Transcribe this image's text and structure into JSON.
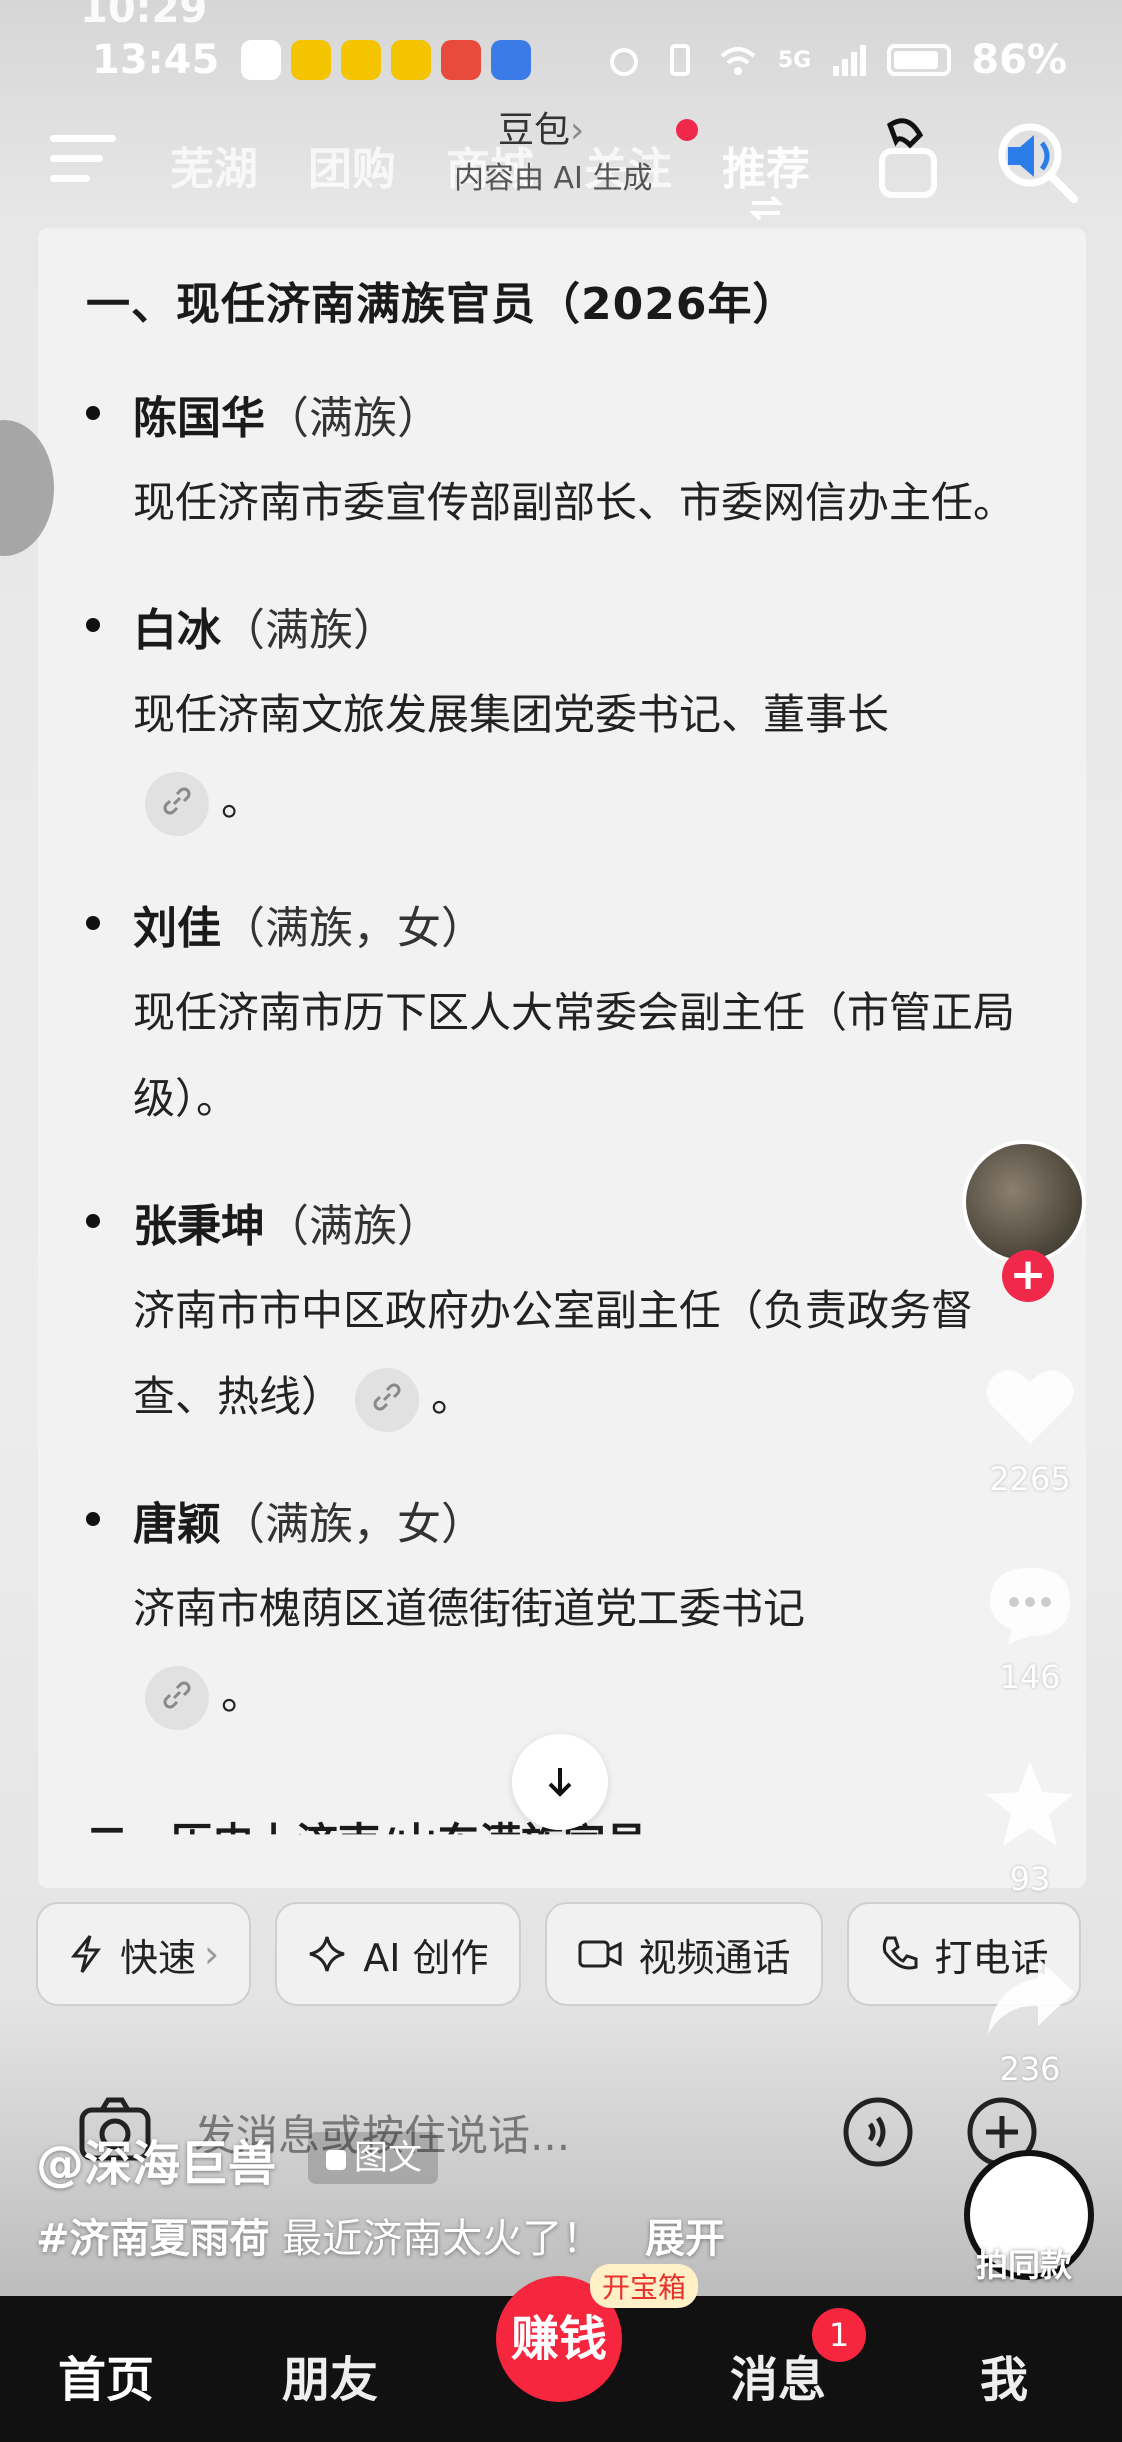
{
  "status_bar": {
    "ghost_time": "10:29",
    "time": "13:45",
    "network": "5G",
    "battery": "86%"
  },
  "top_nav": {
    "tabs": [
      "芜湖",
      "团购",
      "商城",
      "关注",
      "推荐"
    ],
    "assistant_title": "豆包",
    "assistant_chevron": "›",
    "ai_note": "内容由 AI 生成"
  },
  "article": {
    "section_title": "一、现任济南满族官员（2026年）",
    "entries": [
      {
        "name": "陈国华",
        "tag": "（满族）",
        "desc": "现任济南市委宣传部副部长、市委网信办主任。"
      },
      {
        "name": "白冰",
        "tag": "（满族）",
        "desc": "现任济南文旅发展集团党委书记、董事长",
        "tail": "。"
      },
      {
        "name": "刘佳",
        "tag": "（满族，女）",
        "desc": "现任济南市历下区人大常委会副主任（市管正局级）。"
      },
      {
        "name": "张秉坤",
        "tag": "（满族）",
        "desc": "济南市市中区政府办公室副主任（负责政务督查、热线）",
        "tail": "。"
      },
      {
        "name": "唐颖",
        "tag": "（满族，女）",
        "desc": "济南市槐荫区道德街街道党工委书记",
        "tail": "。"
      }
    ],
    "next_section_partial": "二、历史上济南/山东满族官员"
  },
  "action_chips": [
    {
      "label": "快速",
      "icon": "lightning-icon",
      "chevron": "›"
    },
    {
      "label": "AI 创作",
      "icon": "sparkle-icon"
    },
    {
      "label": "视频通话",
      "icon": "video-icon"
    },
    {
      "label": "打电话",
      "icon": "phone-icon"
    }
  ],
  "input": {
    "placeholder": "发消息或按住说话..."
  },
  "side_rail": {
    "likes": "2265",
    "comments": "146",
    "favorites": "93",
    "shares": "236",
    "follow": "+"
  },
  "caption": {
    "author": "@深海巨兽",
    "type_badge": "图文",
    "hashtag": "#济南夏雨荷",
    "text": "最近济南太火了！",
    "expand": "展开",
    "sticker_label": "拍同款"
  },
  "bottom_nav": {
    "home": "首页",
    "friends": "朋友",
    "earn": "赚钱",
    "earn_badge": "开宝箱",
    "messages": "消息",
    "messages_badge": "1",
    "me": "我"
  },
  "colors": {
    "accent_red": "#f5263e",
    "follow_red": "#f0284a",
    "nav_bg": "#111111"
  }
}
